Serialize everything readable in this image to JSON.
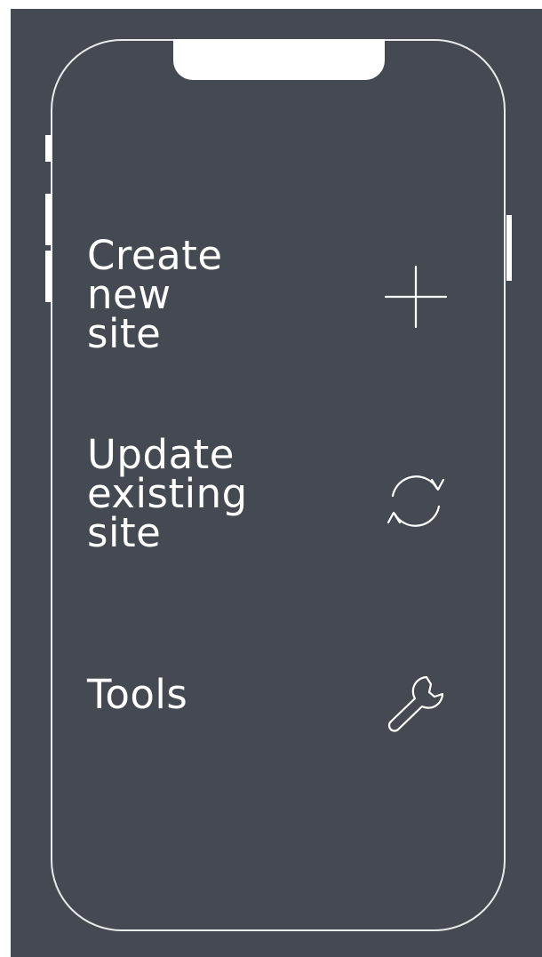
{
  "menu": {
    "items": [
      {
        "label": "Create\nnew\nsite",
        "icon": "plus-icon"
      },
      {
        "label": "Update\nexisting\nsite",
        "icon": "refresh-icon"
      },
      {
        "label": "Tools",
        "icon": "wrench-icon"
      }
    ]
  },
  "colors": {
    "background": "#454a52",
    "foreground": "#ffffff",
    "frame_outline": "#e9eaec"
  }
}
